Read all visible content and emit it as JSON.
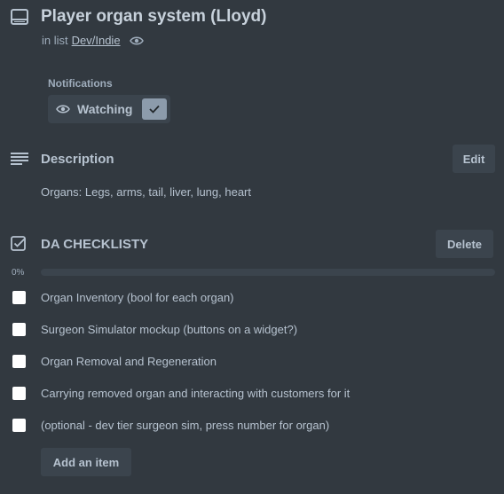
{
  "card": {
    "title": "Player organ system (Lloyd)",
    "in_list_prefix": "in list",
    "list_name": "Dev/Indie"
  },
  "notifications": {
    "label": "Notifications",
    "watch_label": "Watching",
    "watching": true
  },
  "description": {
    "title": "Description",
    "edit_label": "Edit",
    "text": "Organs: Legs, arms, tail, liver, lung, heart"
  },
  "checklist": {
    "title": "DA CHECKLISTY",
    "delete_label": "Delete",
    "progress_label": "0%",
    "progress_percent": 0,
    "items": [
      {
        "text": "Organ Inventory (bool for each organ)",
        "checked": false
      },
      {
        "text": "Surgeon Simulator mockup (buttons on a widget?)",
        "checked": false
      },
      {
        "text": "Organ Removal and Regeneration",
        "checked": false
      },
      {
        "text": "Carrying removed organ and interacting with customers for it",
        "checked": false
      },
      {
        "text": "(optional - dev tier surgeon sim, press number for organ)",
        "checked": false
      }
    ],
    "add_item_label": "Add an item"
  },
  "icons": {
    "card": "card-icon",
    "watch": "eye-icon",
    "check": "checkmark-icon",
    "description": "description-lines-icon",
    "checklist": "checklist-icon"
  },
  "colors": {
    "background": "#323940",
    "button": "#3b444d",
    "progress_fill": "#4bce97",
    "checkbox": "#ffffff",
    "watch_check_bg": "#8c9bab"
  }
}
